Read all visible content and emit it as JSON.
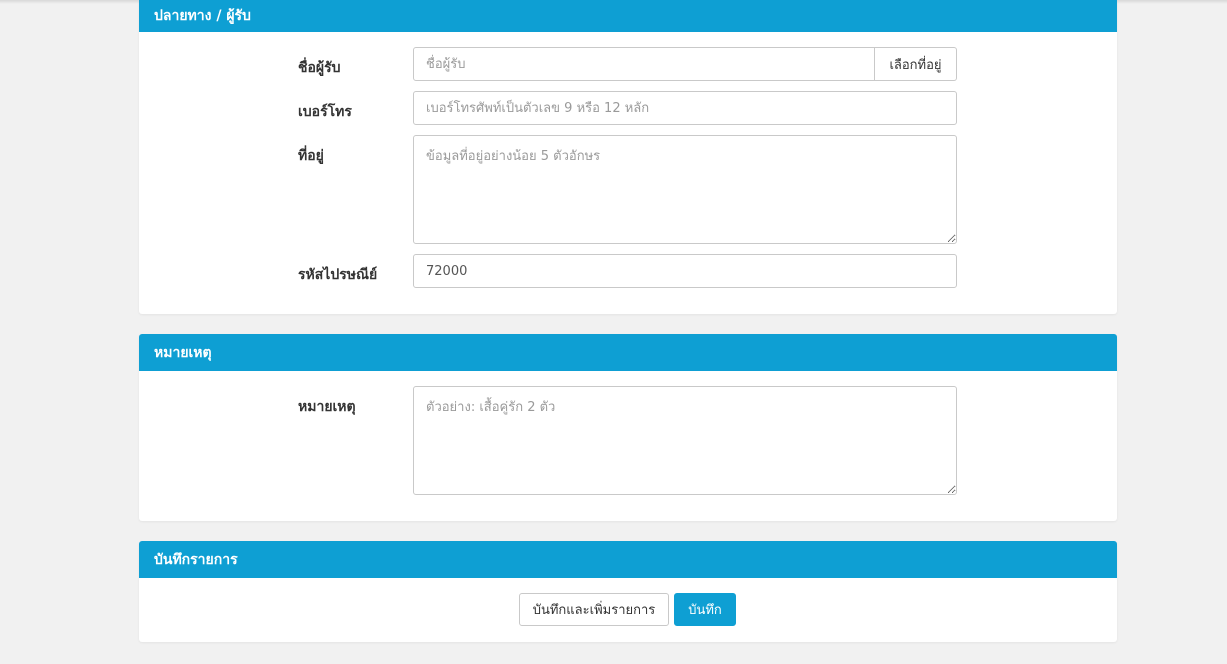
{
  "destination": {
    "heading": "ปลายทาง / ผู้รับ",
    "recipient_name": {
      "label": "ชื่อผู้รับ",
      "placeholder": "ชื่อผู้รับ",
      "value": "",
      "choose_address_label": "เลือกที่อยู่"
    },
    "phone": {
      "label": "เบอร์โทร",
      "placeholder": "เบอร์โทรศัพท์เป็นตัวเลข 9 หรือ 12 หลัก",
      "value": ""
    },
    "address": {
      "label": "ที่อยู่",
      "placeholder": "ข้อมูลที่อยู่อย่างน้อย 5 ตัวอักษร",
      "value": ""
    },
    "postal_code": {
      "label": "รหัสไปรษณีย์",
      "placeholder": "",
      "value": "72000"
    }
  },
  "remarks": {
    "heading": "หมายเหตุ",
    "note": {
      "label": "หมายเหตุ",
      "placeholder": "ตัวอย่าง: เสื้อคู่รัก 2 ตัว",
      "value": ""
    }
  },
  "save": {
    "heading": "บันทึกรายการ",
    "save_and_add_label": "บันทึกและเพิ่มรายการ",
    "save_label": "บันทึก"
  },
  "colors": {
    "accent": "#0e9fd3",
    "background": "#f1f1f1"
  }
}
